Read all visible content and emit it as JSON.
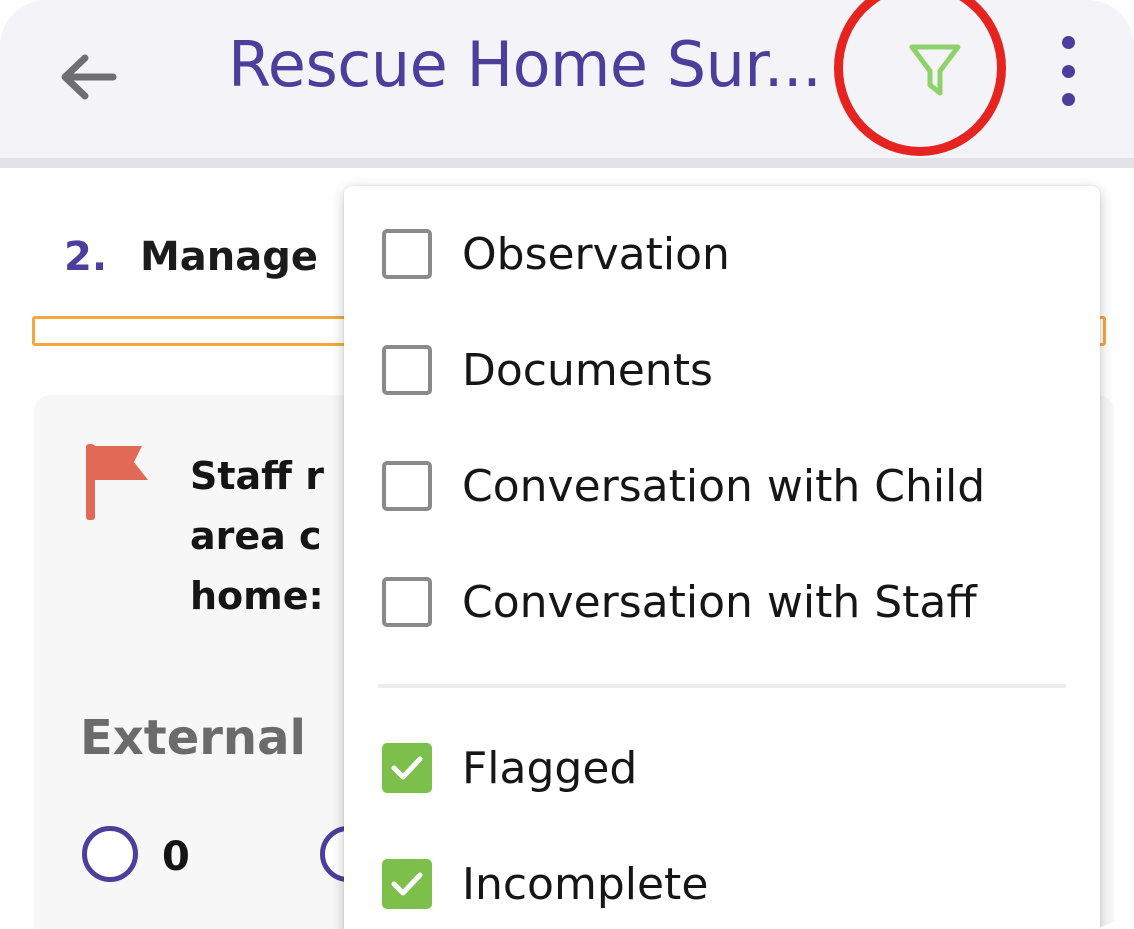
{
  "header": {
    "title": "Rescue Home Sur...",
    "back_icon": "arrow-left-icon",
    "filter_icon": "filter-icon",
    "more_icon": "more-vertical-icon",
    "title_color": "#4b3f9b",
    "filter_color": "#8fd16a",
    "highlight_ring_color": "#e5231f"
  },
  "section": {
    "number": "2.",
    "title": "Manage"
  },
  "question": {
    "flag_icon": "flag-icon",
    "text": "Staff r\narea c\nhome:",
    "flag_color": "#e06a55"
  },
  "field": {
    "label": "External",
    "options": [
      {
        "label": "0"
      },
      {
        "label": ""
      }
    ]
  },
  "filter_menu": {
    "type_filters": [
      {
        "label": "Observation",
        "checked": false
      },
      {
        "label": "Documents",
        "checked": false
      },
      {
        "label": "Conversation with Child",
        "checked": false
      },
      {
        "label": "Conversation with Staff",
        "checked": false
      }
    ],
    "status_filters": [
      {
        "label": "Flagged",
        "checked": true
      },
      {
        "label": "Incomplete",
        "checked": true
      }
    ],
    "check_color": "#7cc04b"
  }
}
